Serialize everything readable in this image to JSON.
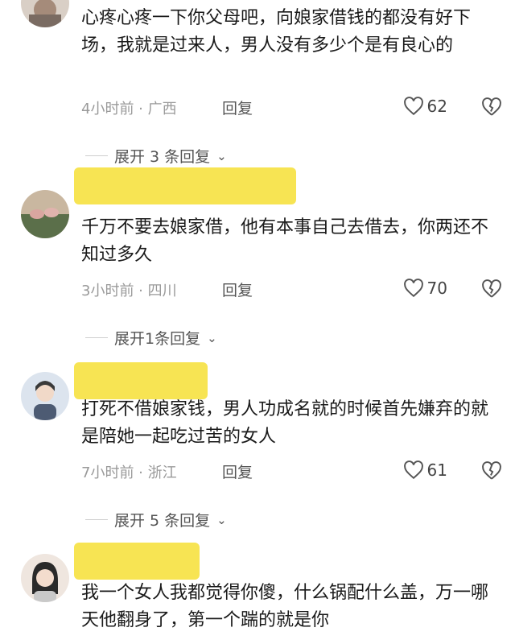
{
  "comments": [
    {
      "text": "心疼心疼一下你父母吧，向娘家借钱的都没有好下场，我就是过来人，男人没有多少个是有良心的",
      "meta": "4小时前 · 广西",
      "reply_label": "回复",
      "likes": "62",
      "expand": "展开 3 条回复"
    },
    {
      "text": "千万不要去娘家借，他有本事自己去借去，你两还不知过多久",
      "meta": "3小时前 · 四川",
      "reply_label": "回复",
      "likes": "70",
      "expand": "展开1条回复"
    },
    {
      "text": "打死不借娘家钱，男人功成名就的时候首先嫌弃的就是陪她一起吃过苦的女人",
      "meta": "7小时前 · 浙江",
      "reply_label": "回复",
      "likes": "61",
      "expand": "展开 5 条回复"
    },
    {
      "text": "我一个女人我都觉得你傻，什么锅配什么盖，万一哪天他翻身了，第一个踹的就是你"
    }
  ]
}
